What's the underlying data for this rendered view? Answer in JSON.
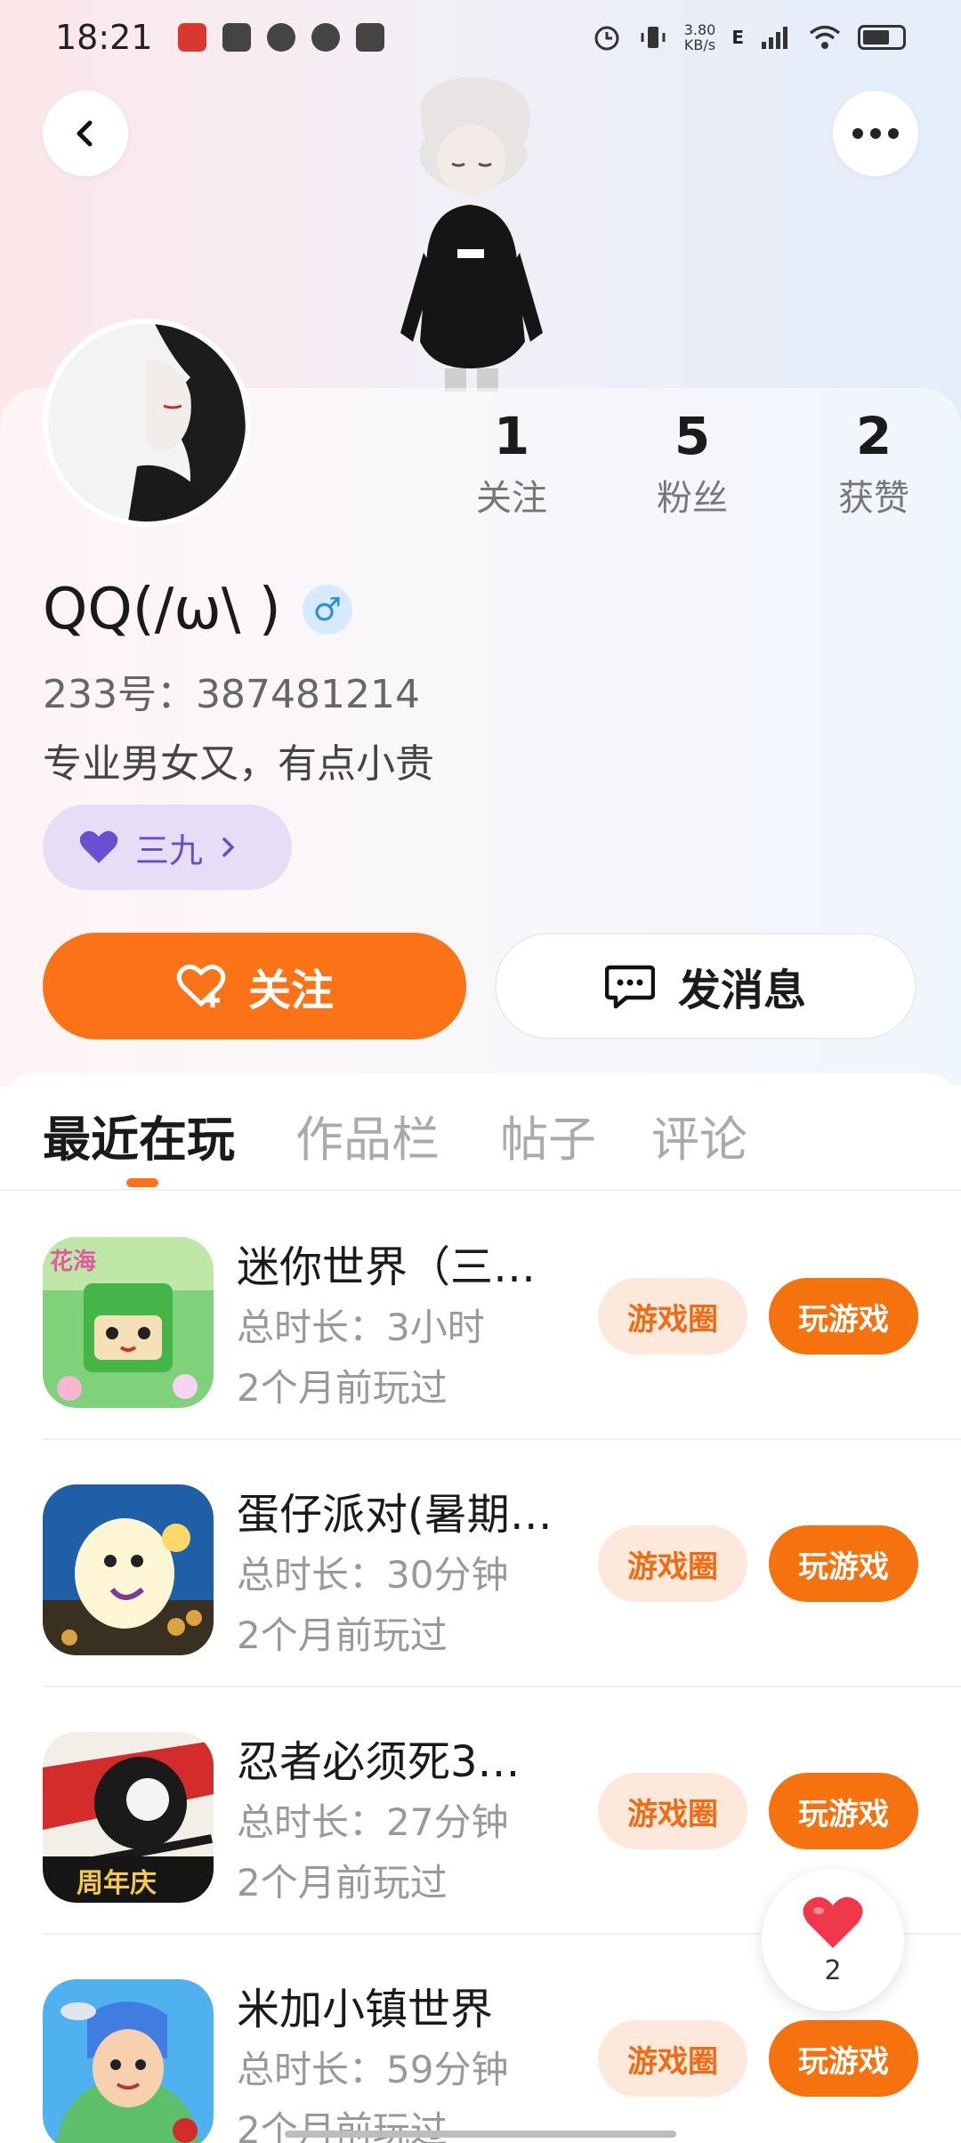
{
  "status_bar": {
    "time": "18:21",
    "net_speed_value": "3.80",
    "net_speed_unit": "KB/s",
    "network_type": "E"
  },
  "profile": {
    "nickname": "QQ(/ω\\ )",
    "gender_symbol": "♂",
    "uid_label": "233号：",
    "uid": "387481214",
    "bio": "专业男女又，有点小贵",
    "tag_label": "三九",
    "stats": [
      {
        "value": "1",
        "label": "关注"
      },
      {
        "value": "5",
        "label": "粉丝"
      },
      {
        "value": "2",
        "label": "获赞"
      }
    ]
  },
  "actions": {
    "follow_label": "关注",
    "message_label": "发消息"
  },
  "tabs": [
    {
      "label": "最近在玩",
      "active": true
    },
    {
      "label": "作品栏",
      "active": false
    },
    {
      "label": "帖子",
      "active": false
    },
    {
      "label": "评论",
      "active": false
    }
  ],
  "games": [
    {
      "name": "迷你世界（三…",
      "duration": "总时长：3小时",
      "last_played": "2个月前玩过",
      "circle_label": "游戏圈",
      "play_label": "玩游戏",
      "icon": "mini-world-icon",
      "icon_text": "花海"
    },
    {
      "name": "蛋仔派对(暑期…",
      "duration": "总时长：30分钟",
      "last_played": "2个月前玩过",
      "circle_label": "游戏圈",
      "play_label": "玩游戏",
      "icon": "eggy-party-icon"
    },
    {
      "name": "忍者必须死3…",
      "duration": "总时长：27分钟",
      "last_played": "2个月前玩过",
      "circle_label": "游戏圈",
      "play_label": "玩游戏",
      "icon": "ninja-must-die-icon",
      "icon_text": "周年庆"
    },
    {
      "name": "米加小镇世界",
      "duration": "总时长：59分钟",
      "last_played": "2个月前玩过",
      "circle_label": "游戏圈",
      "play_label": "玩游戏",
      "icon": "miga-town-icon"
    }
  ],
  "floating_like": {
    "count": "2"
  },
  "colors": {
    "accent": "#fb7316",
    "pill_light": "#fde9dc",
    "tag_bg": "#e6ddf6",
    "tag_text": "#6a4bc8"
  }
}
